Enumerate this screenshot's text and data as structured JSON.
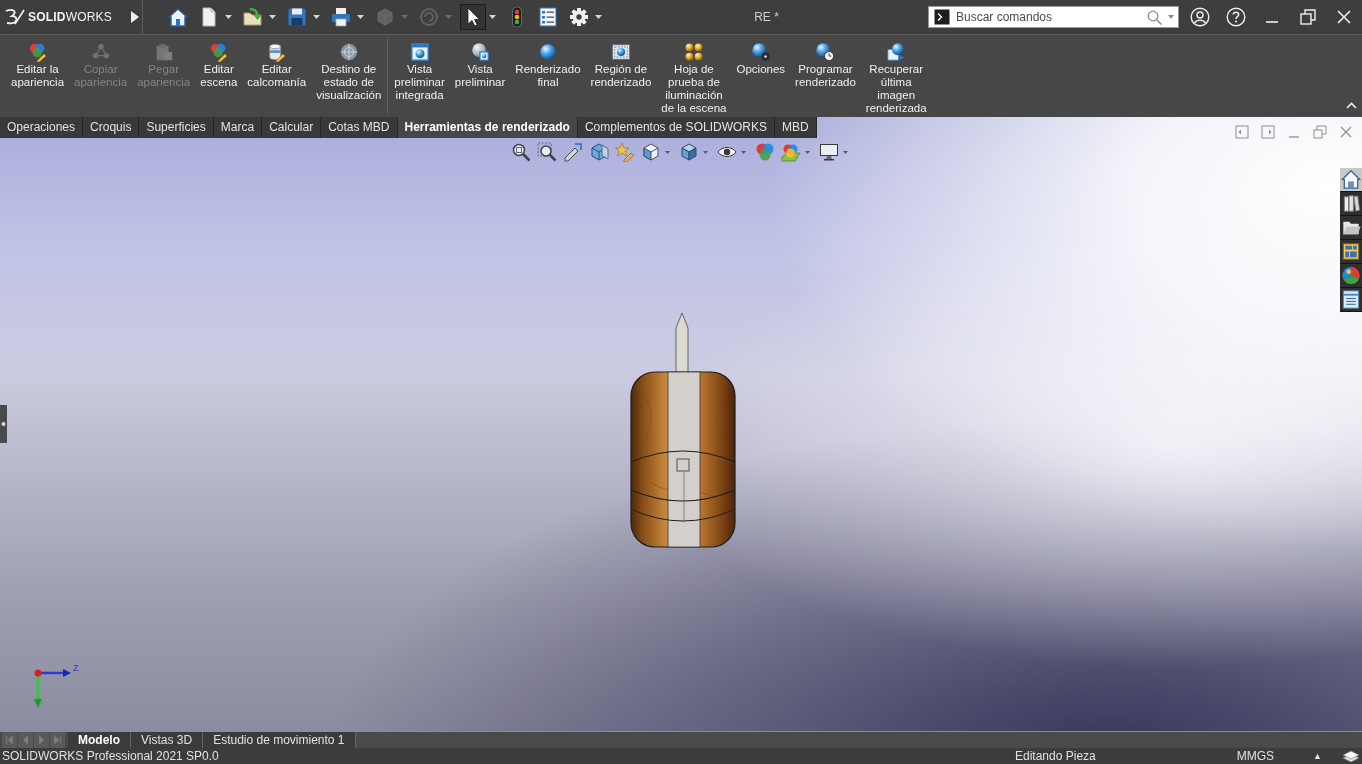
{
  "title_bar": {
    "logo": "**SOLID**WORKS",
    "document_title": "RE *",
    "search": {
      "placeholder": "Buscar comandos"
    }
  },
  "quick_access": [
    {
      "dropdown": false,
      "disabled": false,
      "pressed": false
    },
    {
      "dropdown": true,
      "disabled": false,
      "pressed": false
    },
    {
      "dropdown": true,
      "disabled": false,
      "pressed": false
    },
    {
      "dropdown": true,
      "disabled": false,
      "pressed": false
    },
    {
      "dropdown": true,
      "disabled": false,
      "pressed": false
    },
    {
      "dropdown": true,
      "disabled": true,
      "pressed": false
    },
    {
      "dropdown": true,
      "disabled": true,
      "pressed": false
    },
    {
      "dropdown": true,
      "disabled": false,
      "pressed": true
    },
    {
      "dropdown": false,
      "disabled": false,
      "pressed": false
    },
    {
      "dropdown": false,
      "disabled": false,
      "pressed": false
    },
    {
      "dropdown": true,
      "disabled": false,
      "pressed": false
    }
  ],
  "command_groups": [
    [
      {
        "label": "Editar la\napariencia",
        "disabled": false
      },
      {
        "label": "Copiar\napariencia",
        "disabled": true
      },
      {
        "label": "Pegar\napariencia",
        "disabled": true
      },
      {
        "label": "Editar\nescena",
        "disabled": false
      },
      {
        "label": "Editar\ncalcomanía",
        "disabled": false
      },
      {
        "label": "Destino de\nestado de\nvisualización",
        "disabled": false
      }
    ],
    [
      {
        "label": "Vista\npreliminar\nintegrada",
        "disabled": false
      },
      {
        "label": "Vista\npreliminar",
        "disabled": false
      },
      {
        "label": "Renderizado\nfinal",
        "disabled": false
      },
      {
        "label": "Región de\nrenderizado",
        "disabled": false
      },
      {
        "label": "Hoja de\nprueba de\niluminación\nde la escena",
        "disabled": false
      },
      {
        "label": "Opciones",
        "disabled": false
      },
      {
        "label": "Programar\nrenderizado",
        "disabled": false
      },
      {
        "label": "Recuperar\núltima\nimagen\nrenderizada",
        "disabled": false
      }
    ]
  ],
  "tabs": [
    {
      "label": "Operaciones",
      "selected": false
    },
    {
      "label": "Croquis",
      "selected": false
    },
    {
      "label": "Superficies",
      "selected": false
    },
    {
      "label": "Marca",
      "selected": false
    },
    {
      "label": "Calcular",
      "selected": false
    },
    {
      "label": "Cotas MBD",
      "selected": false
    },
    {
      "label": "Herramientas de renderizado",
      "selected": true
    },
    {
      "label": "Complementos de SOLIDWORKS",
      "selected": false
    },
    {
      "label": "MBD",
      "selected": false
    }
  ],
  "view_toolbar": [
    {
      "dropdown": false
    },
    {
      "dropdown": false
    },
    {
      "dropdown": false
    },
    {
      "dropdown": false
    },
    {
      "dropdown": false
    },
    {
      "dropdown": true
    },
    {
      "dropdown": true
    },
    {
      "dropdown": true
    },
    {
      "dropdown": false
    },
    {
      "dropdown": true
    },
    {
      "dropdown": true
    }
  ],
  "task_pane": [
    {
      "selected": true
    },
    {
      "selected": false
    },
    {
      "selected": false
    },
    {
      "selected": false
    },
    {
      "selected": false
    },
    {
      "selected": false
    }
  ],
  "triad": {
    "axis_label": "Z"
  },
  "bottom_tabs": [
    {
      "label": "Modelo",
      "selected": true
    },
    {
      "label": "Vistas 3D",
      "selected": false
    },
    {
      "label": "Estudio de movimiento 1",
      "selected": false
    }
  ],
  "status_bar": {
    "product": "SOLIDWORKS Professional 2021 SP0.0",
    "mode": "Editando Pieza",
    "units": "MMGS",
    "units_arrow": "▲"
  }
}
